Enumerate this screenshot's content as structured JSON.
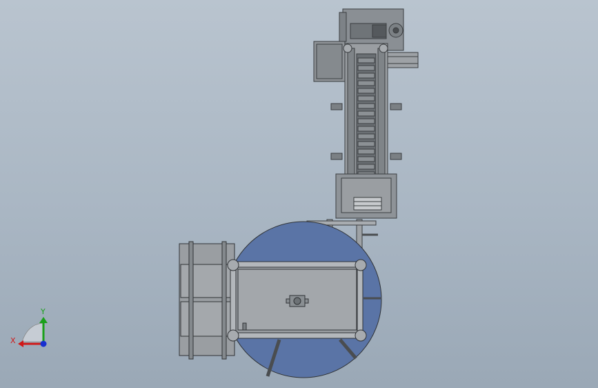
{
  "viewport": {
    "background_top": "#b9c4cf",
    "background_bottom": "#9aa8b6"
  },
  "model": {
    "frame_color": "#8e9398",
    "frame_dark": "#3a3d40",
    "turntable_color": "#5a74a6",
    "plate_color": "#9a9ea2"
  },
  "triad": {
    "x_label": "X",
    "y_label": "Y",
    "x_color": "#d01818",
    "y_color": "#1aa01a",
    "z_color": "#1830d0"
  }
}
